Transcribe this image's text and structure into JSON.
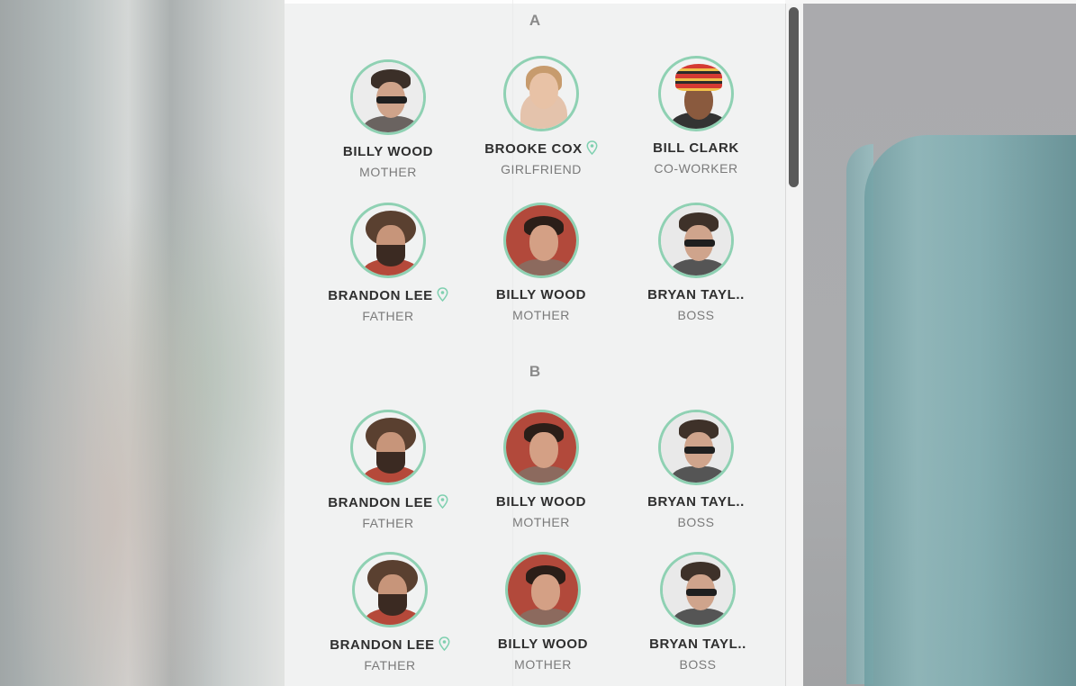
{
  "sections": [
    {
      "letter": "A",
      "contacts": [
        {
          "name": "BILLY WOOD",
          "relation": "MOTHER",
          "has_location": false,
          "avatar": "man-sunglasses"
        },
        {
          "name": "BROOKE COX",
          "relation": "GIRLFRIEND",
          "has_location": true,
          "avatar": "woman"
        },
        {
          "name": "BILL CLARK",
          "relation": "CO-WORKER",
          "has_location": false,
          "avatar": "man-red-hat"
        },
        {
          "name": "BRANDON LEE",
          "relation": "FATHER",
          "has_location": true,
          "avatar": "man-beard"
        },
        {
          "name": "BILLY WOOD",
          "relation": "MOTHER",
          "has_location": false,
          "avatar": "man-red-background"
        },
        {
          "name": "BRYAN TAYL..",
          "relation": "BOSS",
          "has_location": false,
          "avatar": "man-sunglasses-profile"
        }
      ]
    },
    {
      "letter": "B",
      "contacts": [
        {
          "name": "BRANDON LEE",
          "relation": "FATHER",
          "has_location": true,
          "avatar": "man-beard"
        },
        {
          "name": "BILLY WOOD",
          "relation": "MOTHER",
          "has_location": false,
          "avatar": "man-red-background"
        },
        {
          "name": "BRYAN TAYL..",
          "relation": "BOSS",
          "has_location": false,
          "avatar": "man-sunglasses-profile"
        },
        {
          "name": "BRANDON LEE",
          "relation": "FATHER",
          "has_location": true,
          "avatar": "man-beard"
        },
        {
          "name": "BILLY WOOD",
          "relation": "MOTHER",
          "has_location": false,
          "avatar": "man-red-background"
        },
        {
          "name": "BRYAN TAYL..",
          "relation": "BOSS",
          "has_location": false,
          "avatar": "man-sunglasses-profile"
        }
      ]
    }
  ],
  "colors": {
    "avatar_ring": "#8fd1b3",
    "location_pin": "#7fd0b0",
    "name_text": "#2f2f2f",
    "relation_text": "#7a7a7a",
    "section_letter": "#8a8a8a"
  }
}
